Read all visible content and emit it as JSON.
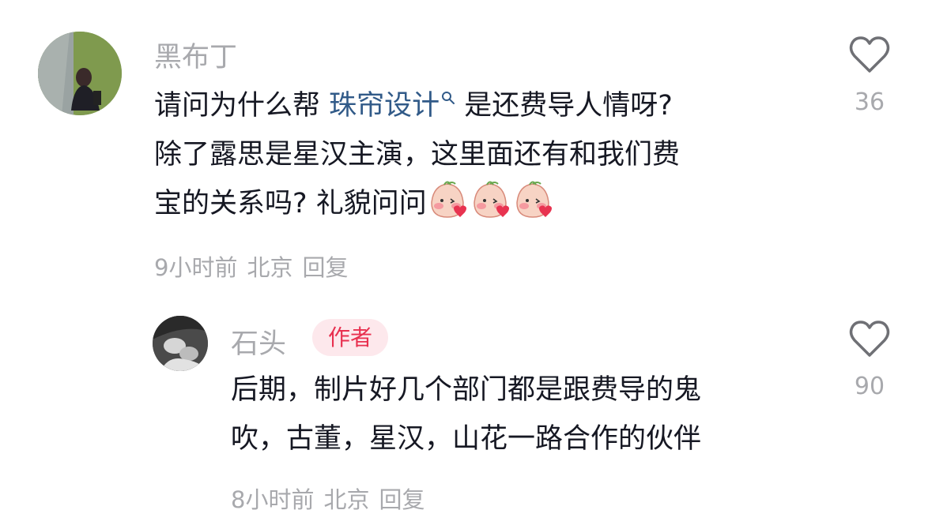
{
  "comments": [
    {
      "username": "黑布丁",
      "text_lines": [
        {
          "before": "请问为什么帮 ",
          "mention": "珠帘设计",
          "after": " 是还费导人情呀?"
        },
        {
          "text": "除了露思是星汉主演，这里面还有和我们费"
        },
        {
          "text": "宝的关系吗? 礼貌问问"
        }
      ],
      "emoji": [
        "blush-kiss-emoji",
        "blush-kiss-emoji",
        "blush-kiss-emoji"
      ],
      "time": "9小时前",
      "location": "北京",
      "reply_label": "回复",
      "like_count": "36"
    },
    {
      "username": "石头",
      "badge": "作者",
      "text_lines": [
        {
          "text": "后期，制片好几个部门都是跟费导的鬼"
        },
        {
          "text": "吹，古董，星汉，山花一路合作的伙伴"
        }
      ],
      "time": "8小时前",
      "location": "北京",
      "reply_label": "回复",
      "like_count": "90"
    }
  ],
  "icons": {
    "like": "heart-outline-icon",
    "mention_search": "search-icon"
  },
  "colors": {
    "text": "#161823",
    "secondary": "#a8a9ad",
    "mention": "#315a88",
    "badge_bg": "#fde8ec",
    "badge_text": "#e8304f"
  }
}
